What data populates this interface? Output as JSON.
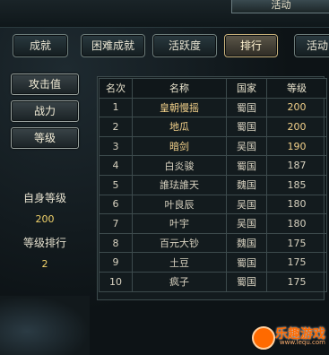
{
  "header": {
    "title": "活动"
  },
  "tabs": [
    {
      "label": "成就"
    },
    {
      "label": "困难成就"
    },
    {
      "label": "活跃度"
    },
    {
      "label": "排行",
      "active": true
    },
    {
      "label": "活动"
    }
  ],
  "sidebar": {
    "buttons": [
      {
        "label": "攻击值"
      },
      {
        "label": "战力"
      },
      {
        "label": "等级"
      }
    ],
    "self_level_label": "自身等级",
    "self_level_value": "200",
    "level_rank_label": "等级排行",
    "level_rank_value": "2"
  },
  "table": {
    "headers": [
      "名次",
      "名称",
      "国家",
      "等级"
    ],
    "rows": [
      {
        "rank": "1",
        "name": "皇朝慢摇",
        "country": "蜀国",
        "level": "200"
      },
      {
        "rank": "2",
        "name": "地瓜",
        "country": "蜀国",
        "level": "200"
      },
      {
        "rank": "3",
        "name": "暗剑",
        "country": "吴国",
        "level": "190"
      },
      {
        "rank": "4",
        "name": "白炎骏",
        "country": "蜀国",
        "level": "187"
      },
      {
        "rank": "5",
        "name": "誰珐誰天",
        "country": "魏国",
        "level": "185"
      },
      {
        "rank": "6",
        "name": "叶良辰",
        "country": "吴国",
        "level": "180"
      },
      {
        "rank": "7",
        "name": "叶宇",
        "country": "吴国",
        "level": "180"
      },
      {
        "rank": "8",
        "name": "百元大钞",
        "country": "魏国",
        "level": "175"
      },
      {
        "rank": "9",
        "name": "土豆",
        "country": "蜀国",
        "level": "175"
      },
      {
        "rank": "10",
        "name": "疯子",
        "country": "蜀国",
        "level": "175"
      }
    ]
  },
  "watermark": {
    "text": "乐趣游戏",
    "url": "www.lequ.com"
  }
}
